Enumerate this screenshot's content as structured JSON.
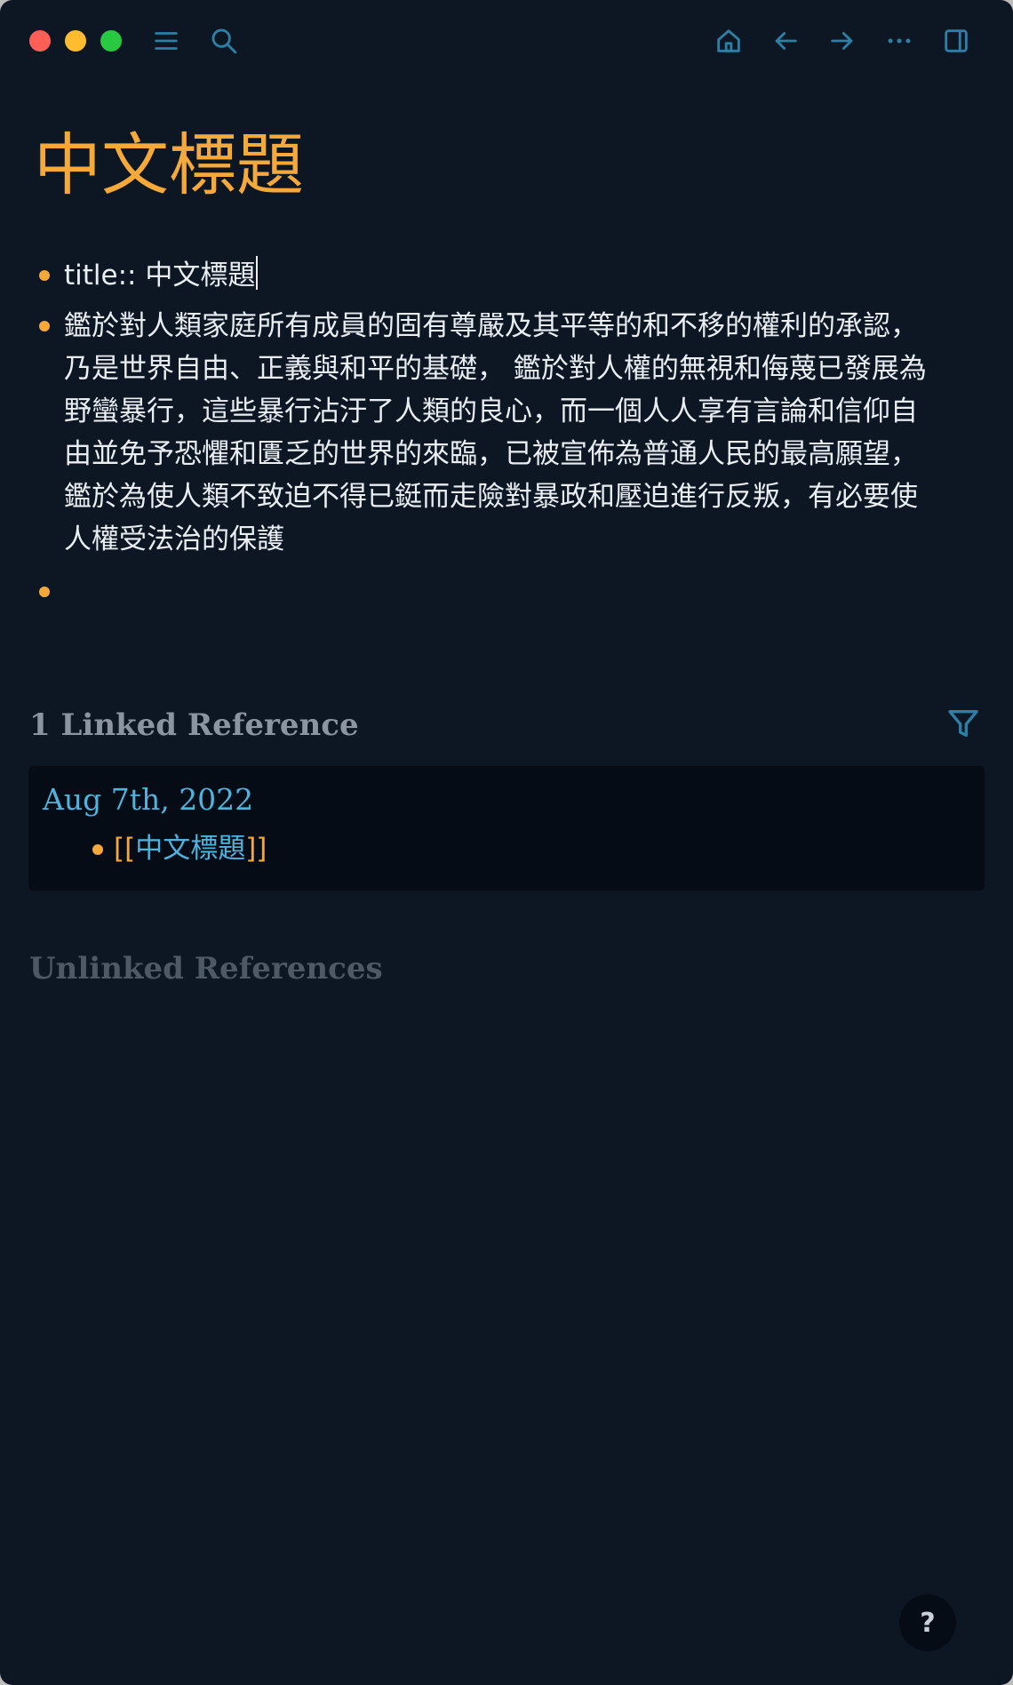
{
  "titlebar": {
    "icons": [
      "menu-icon",
      "search-icon",
      "home-icon",
      "arrow-left-icon",
      "arrow-right-icon",
      "more-icon",
      "sidebar-toggle-icon"
    ],
    "icon_color": "#2d7fa6"
  },
  "page": {
    "title": "中文標題",
    "blocks": [
      {
        "text": "title:: 中文標題"
      },
      {
        "text": "鑑於對人類家庭所有成員的固有尊嚴及其平等的和不移的權利的承認，\n乃是世界自由、正義與和平的基礎， 鑑於對人權的無視和侮蔑已發展為\n野蠻暴行，這些暴行沾汙了人類的良心，而一個人人享有言論和信仰自\n由並免予恐懼和匱乏的世界的來臨，已被宣佈為普通人民的最高願望，\n鑑於為使人類不致迫不得已鋌而走險對暴政和壓迫進行反叛，有必要使\n人權受法治的保護"
      },
      {
        "text": ""
      }
    ]
  },
  "references": {
    "linked_title": "1 Linked Reference",
    "linked": [
      {
        "date": "Aug 7th, 2022",
        "open_bracket": "[[",
        "page": "中文標題",
        "close_bracket": "]]"
      }
    ],
    "unlinked_title": "Unlinked References"
  },
  "help": {
    "label": "?"
  },
  "colors": {
    "background": "#0d1724",
    "accent_orange": "#f5a93b",
    "accent_blue": "#4fb3dd",
    "text": "#e9eef3"
  }
}
